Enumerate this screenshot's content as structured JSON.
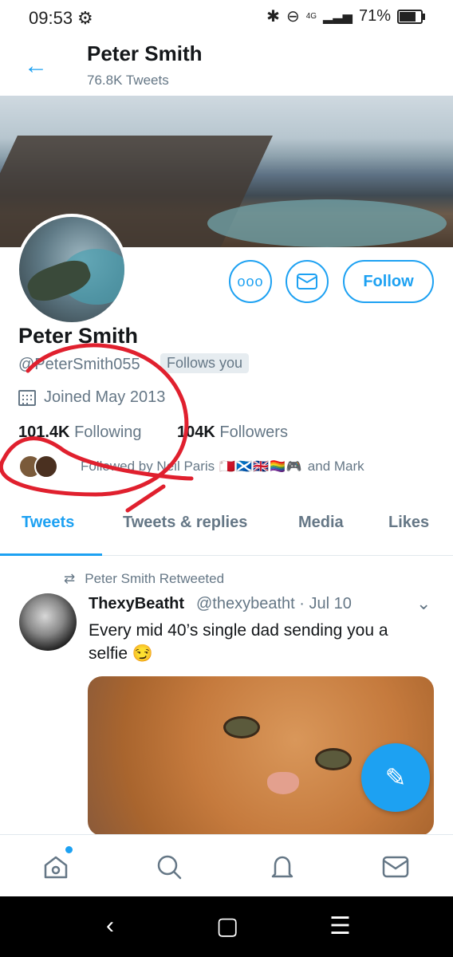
{
  "status": {
    "time": "09:53",
    "network": "4G",
    "battery": "71%",
    "battery_level": 0.71
  },
  "header": {
    "title": "Peter Smith",
    "subtitle": "76.8K Tweets"
  },
  "profile": {
    "name": "Peter Smith",
    "handle": "@PeterSmith055",
    "follows_you": "Follows you",
    "joined": "Joined May 2013",
    "following_count": "101.4K",
    "following_label": "Following",
    "followers_count": "104K",
    "followers_label": "Followers",
    "followed_by_prefix": "Followed by Neil Paris",
    "followed_by_suffix": "and Mark",
    "follow_button": "Follow"
  },
  "tabs": [
    "Tweets",
    "Tweets & replies",
    "Media",
    "Likes"
  ],
  "tweet": {
    "retweet_label": "Peter Smith Retweeted",
    "author_name": "ThexyBeatht",
    "author_handle": "@thexybeatht",
    "date": "· Jul 10",
    "text": "Every mid 40’s single dad sending you a selfie 😏"
  },
  "colors": {
    "accent": "#1da1f2",
    "secondary_text": "#657786",
    "annotation": "#e0202e"
  }
}
